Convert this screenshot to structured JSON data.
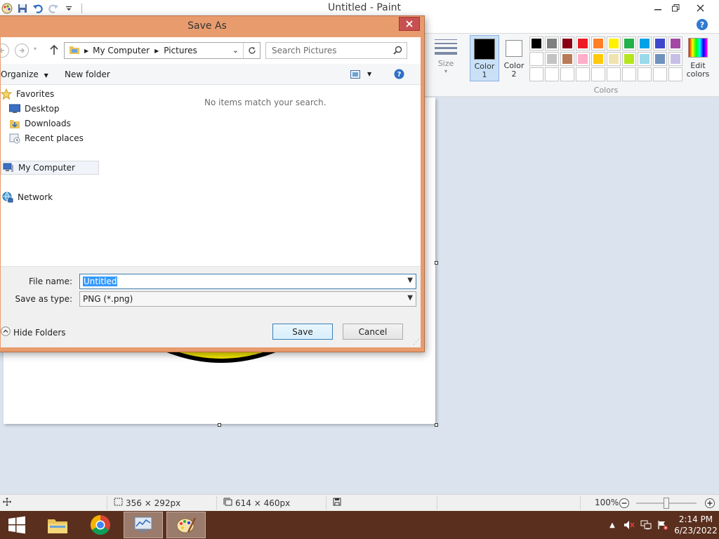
{
  "app": {
    "title": "Untitled - Paint"
  },
  "ribbon": {
    "size_label": "Size",
    "color1_label_line1": "Color",
    "color1_label_line2": "1",
    "color2_label_line1": "Color",
    "color2_label_line2": "2",
    "edit_colors_line1": "Edit",
    "edit_colors_line2": "colors",
    "colors_group_label": "Colors",
    "color1_value": "#000000",
    "color2_value": "#ffffff",
    "palette": [
      "#000000",
      "#7f7f7f",
      "#880015",
      "#ed1c24",
      "#ff7f27",
      "#fff200",
      "#22b14c",
      "#00a2e8",
      "#3f48cc",
      "#a349a4",
      "#ffffff",
      "#c3c3c3",
      "#b97a57",
      "#ffaec9",
      "#ffc90e",
      "#efe4b0",
      "#b5e61d",
      "#99d9ea",
      "#7092be",
      "#c8bfe7",
      "",
      "",
      "",
      "",
      "",
      "",
      "",
      "",
      "",
      ""
    ]
  },
  "statusbar": {
    "selection_size": "356 × 292px",
    "canvas_size": "614 × 460px",
    "zoom": "100%",
    "zoom_fraction": 0.5
  },
  "taskbar": {
    "time": "2:14 PM",
    "date": "6/23/2022"
  },
  "dialog": {
    "title": "Save As",
    "address": {
      "segment1": "My Computer",
      "segment2": "Pictures"
    },
    "search_placeholder": "Search Pictures",
    "organize_label": "Organize",
    "new_folder_label": "New folder",
    "nav": {
      "favorites": "Favorites",
      "desktop": "Desktop",
      "downloads": "Downloads",
      "recent_places": "Recent places",
      "my_computer": "My Computer",
      "network": "Network"
    },
    "empty_message": "No items match your search.",
    "file_name_label": "File name:",
    "file_name_value": "Untitled",
    "save_as_type_label": "Save as type:",
    "save_as_type_value": "PNG (*.png)",
    "hide_folders_label": "Hide Folders",
    "save_label": "Save",
    "cancel_label": "Cancel"
  }
}
